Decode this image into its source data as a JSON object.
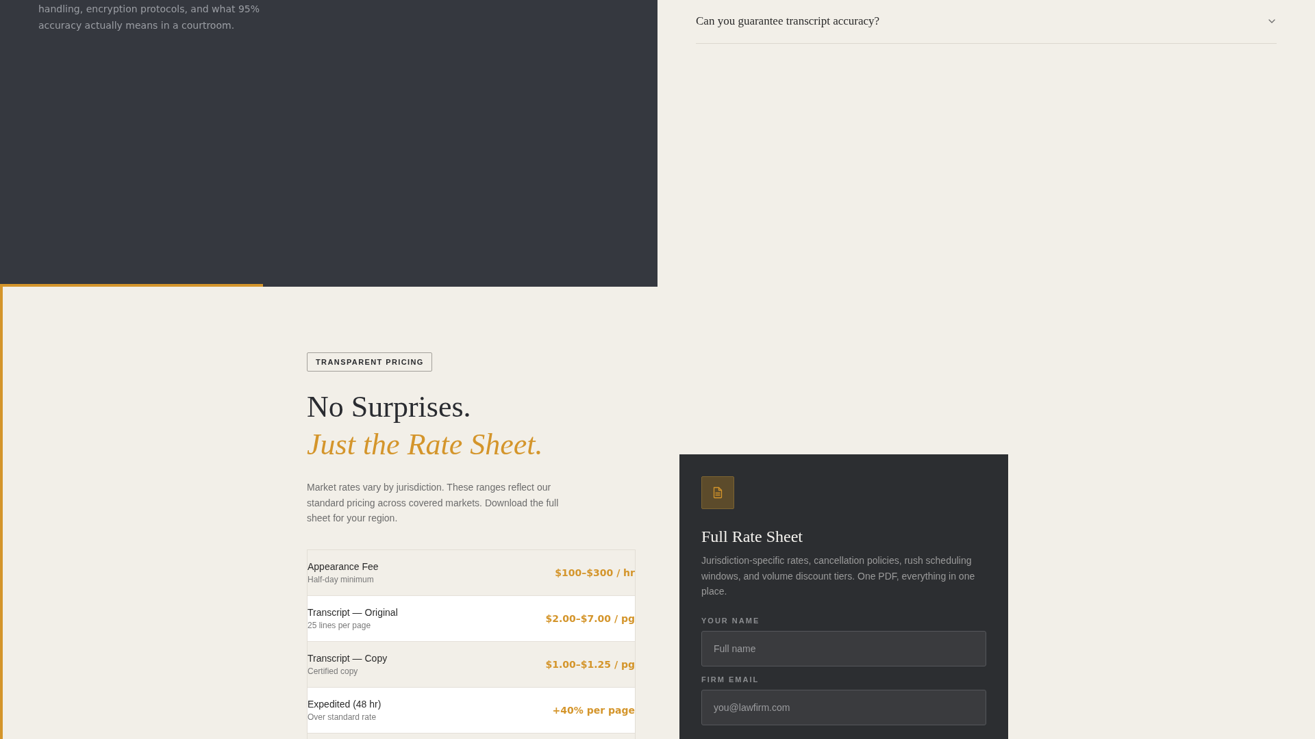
{
  "intro_panel": {
    "text": "handling, encryption protocols, and what 95% accuracy actually means in a courtroom."
  },
  "faq": [
    {
      "question": "Can you guarantee transcript accuracy?",
      "expanded": false
    }
  ],
  "pricing": {
    "badge": "TRANSPARENT PRICING",
    "title": "No Surprises.",
    "title_accent": "Just the Rate Sheet.",
    "description": "Market rates vary by jurisdiction. These ranges reflect our standard pricing across covered markets. Download the full sheet for your region.",
    "rates": [
      {
        "name": "Appearance Fee",
        "note": "Half-day minimum",
        "price": "$100–$300 / hr"
      },
      {
        "name": "Transcript — Original",
        "note": "25 lines per page",
        "price": "$2.00–$7.00 / pg"
      },
      {
        "name": "Transcript — Copy",
        "note": "Certified copy",
        "price": "$1.00–$1.25 / pg"
      },
      {
        "name": "Expedited (48 hr)",
        "note": "Over standard rate",
        "price": "+40% per page"
      }
    ]
  },
  "rate_sheet_card": {
    "title": "Full Rate Sheet",
    "description": "Jurisdiction-specific rates, cancellation policies, rush scheduling windows, and volume discount tiers. One PDF, everything in one place.",
    "fields": [
      {
        "label": "YOUR NAME",
        "placeholder": "Full name"
      },
      {
        "label": "FIRM EMAIL",
        "placeholder": "you@lawfirm.com"
      }
    ]
  }
}
